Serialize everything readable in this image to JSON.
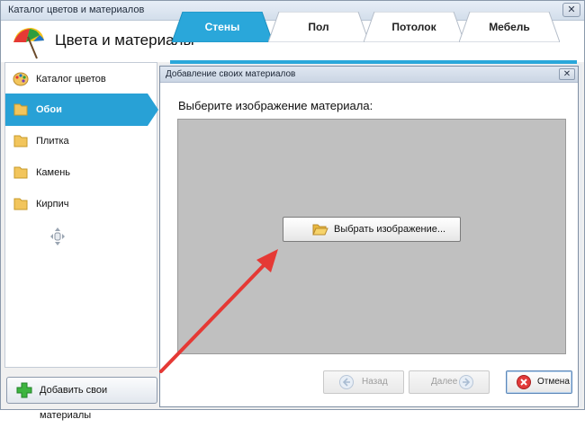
{
  "window": {
    "title": "Каталог цветов и материалов",
    "close_glyph": "✕"
  },
  "header": {
    "title": "Цвета и материалы"
  },
  "tabs": [
    {
      "label": "Стены",
      "active": true
    },
    {
      "label": "Пол",
      "active": false
    },
    {
      "label": "Потолок",
      "active": false
    },
    {
      "label": "Мебель",
      "active": false
    }
  ],
  "sidebar": {
    "items": [
      {
        "label": "Каталог цветов",
        "icon": "palette-icon",
        "active": false
      },
      {
        "label": "Обои",
        "icon": "folder-icon",
        "active": true
      },
      {
        "label": "Плитка",
        "icon": "folder-icon",
        "active": false
      },
      {
        "label": "Камень",
        "icon": "folder-icon",
        "active": false
      },
      {
        "label": "Кирпич",
        "icon": "folder-icon",
        "active": false
      }
    ],
    "add_button": "Добавить свои материалы"
  },
  "dialog": {
    "title": "Добавление своих материалов",
    "close_glyph": "✕",
    "prompt": "Выберите изображение материала:",
    "choose_button": "Выбрать изображение...",
    "back_button": "Назад",
    "next_button": "Далее",
    "cancel_button": "Отмена"
  },
  "colors": {
    "accent": "#28a1d6",
    "annotation_arrow": "#e53935",
    "image_area": "#c0c0c0"
  }
}
